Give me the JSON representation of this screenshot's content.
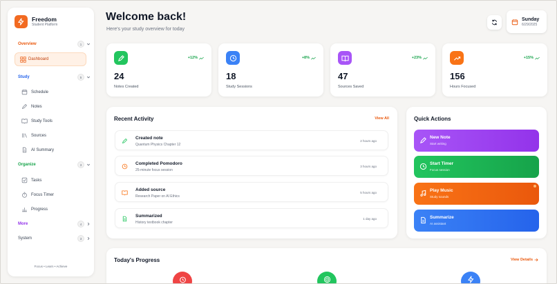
{
  "brand": {
    "name": "Freedom",
    "subtitle": "Student Platform"
  },
  "sidebar": {
    "overview": {
      "title": "Overview",
      "count": "1",
      "color": "#ea580c"
    },
    "dashboard": "Dashboard",
    "study": {
      "title": "Study",
      "count": "5",
      "color": "#2563eb",
      "items": [
        "Schedule",
        "Notes",
        "Study Tools",
        "Sources",
        "AI Summary"
      ]
    },
    "organize": {
      "title": "Organize",
      "count": "3",
      "color": "#16a34a",
      "items": [
        "Tasks",
        "Focus Timer",
        "Progress"
      ]
    },
    "more": {
      "title": "More",
      "count": "4",
      "color": "#9333ea"
    },
    "system": {
      "title": "System",
      "count": "3",
      "color": "#374151"
    },
    "footer": "Focus • Learn • Achieve"
  },
  "header": {
    "title": "Welcome back!",
    "subtitle": "Here's your study overview for today",
    "day": "Sunday",
    "date": "6/29/2025"
  },
  "stats": [
    {
      "value": "24",
      "label": "Notes Created",
      "trend": "+12%",
      "icon": "pen-icon",
      "color": "#22c55e"
    },
    {
      "value": "18",
      "label": "Study Sessions",
      "trend": "+8%",
      "icon": "clock-icon",
      "color": "#3b82f6"
    },
    {
      "value": "47",
      "label": "Sources Saved",
      "trend": "+23%",
      "icon": "book-icon",
      "color": "#a855f7"
    },
    {
      "value": "156",
      "label": "Hours Focused",
      "trend": "+15%",
      "icon": "trend-up-icon",
      "color": "#f97316"
    }
  ],
  "recent": {
    "title": "Recent Activity",
    "view_all": "View All",
    "items": [
      {
        "title": "Created note",
        "desc": "Quantum Physics Chapter 12",
        "time": "2 hours ago",
        "icon": "pen-icon",
        "color": "#22c55e"
      },
      {
        "title": "Completed Pomodoro",
        "desc": "25-minute focus session",
        "time": "3 hours ago",
        "icon": "clock-icon",
        "color": "#f97316"
      },
      {
        "title": "Added source",
        "desc": "Research Paper on AI Ethics",
        "time": "5 hours ago",
        "icon": "book-icon",
        "color": "#f97316"
      },
      {
        "title": "Summarized",
        "desc": "History textbook chapter",
        "time": "1 day ago",
        "icon": "document-icon",
        "color": "#22c55e"
      }
    ]
  },
  "quick": {
    "title": "Quick Actions",
    "items": [
      {
        "title": "New Note",
        "sub": "Start writing",
        "color": "#9333ea",
        "icon": "pen-icon"
      },
      {
        "title": "Start Timer",
        "sub": "Focus session",
        "color": "#16a34a",
        "icon": "clock-icon"
      },
      {
        "title": "Play Music",
        "sub": "Study sounds",
        "color": "#ea580c",
        "icon": "music-icon"
      },
      {
        "title": "Summarize",
        "sub": "AI assistant",
        "color": "#2563eb",
        "icon": "document-icon"
      }
    ]
  },
  "progress": {
    "title": "Today's Progress",
    "details": "View Details"
  }
}
